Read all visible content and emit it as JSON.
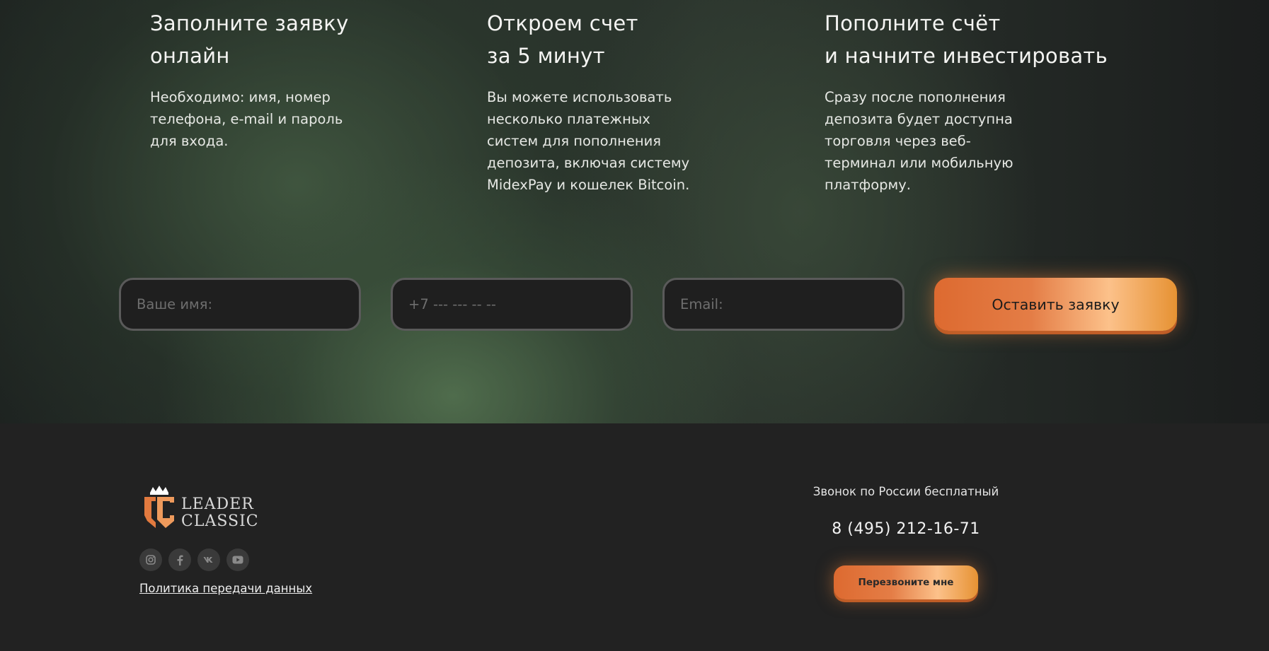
{
  "steps": [
    {
      "title_line1": "Заполните заявку",
      "title_line2": "онлайн",
      "text": "Необходимо: имя, номер телефона, e-mail и пароль для входа."
    },
    {
      "title_line1": "Откроем счет",
      "title_line2": "за 5 минут",
      "text": "Вы можете использовать несколько платежных систем для пополнения депозита, включая систему MidexPay и кошелек Bitcoin."
    },
    {
      "title_line1": "Пополните счёт",
      "title_line2": "и начните инвестировать",
      "text": "Сразу после пополнения депозита будет доступна торговля через веб-терминал или мобильную платформу."
    }
  ],
  "form": {
    "name_placeholder": "Ваше имя:",
    "phone_placeholder": "+7 --- --- -- --",
    "email_placeholder": "Email:",
    "submit_label": "Оставить заявку"
  },
  "footer": {
    "logo": {
      "line1": "LEADER",
      "line2": "CLASSIC"
    },
    "socials": [
      "instagram-icon",
      "facebook-icon",
      "vk-icon",
      "youtube-icon"
    ],
    "policy_link": "Политика передачи данных",
    "callfree_label": "Звонок по России бесплатный",
    "phone": "8 (495) 212-16-71",
    "callback_label": "Перезвоните мне"
  },
  "colors": {
    "accent_orange": "#e47d46",
    "accent_peach": "#fcc18a",
    "footer_bg": "#222222"
  }
}
